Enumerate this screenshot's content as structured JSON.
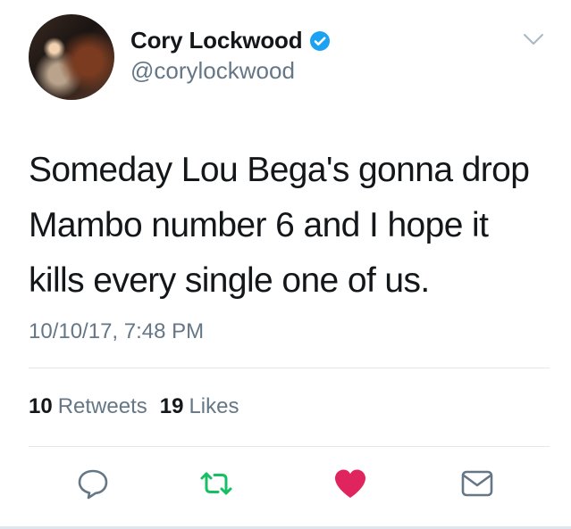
{
  "user": {
    "display_name": "Cory Lockwood",
    "handle": "@corylockwood",
    "verified": true
  },
  "tweet": {
    "text": "Someday Lou Bega's gonna drop\nMambo number 6 and I hope it\nkills every single one of us.",
    "timestamp": "10/10/17, 7:48 PM"
  },
  "stats": {
    "retweets_count": "10",
    "retweets_label": "Retweets",
    "likes_count": "19",
    "likes_label": "Likes"
  },
  "icons": {
    "avatar": "avatar-photo",
    "verified": "verified-badge-icon",
    "more": "chevron-down-icon",
    "reply": "reply-icon",
    "retweet": "retweet-icon",
    "like": "heart-icon",
    "dm": "envelope-icon"
  },
  "colors": {
    "verified_blue": "#1da1f2",
    "retweet_green": "#17bf63",
    "like_red": "#e0245e",
    "secondary_text": "#657786"
  }
}
